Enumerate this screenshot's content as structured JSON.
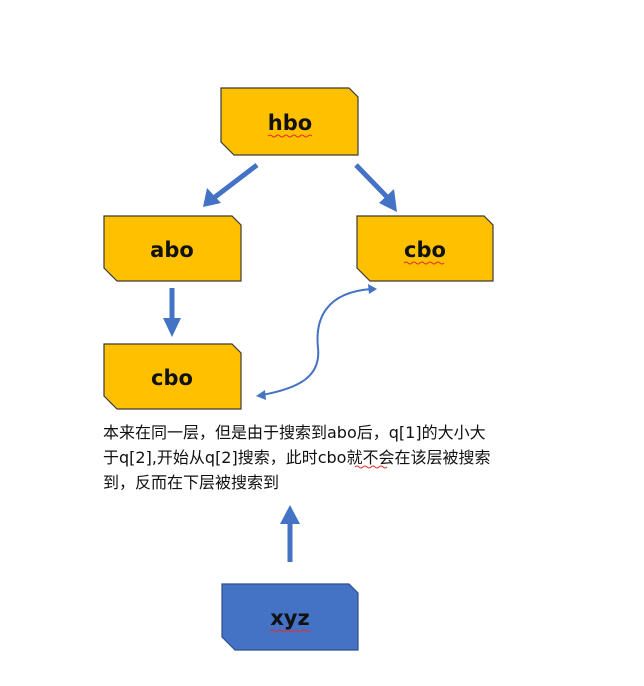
{
  "colors": {
    "node_fill": "#FFC000",
    "node_stroke": "#3a3a3a",
    "query_fill": "#4472C4",
    "query_stroke": "#2f4f8a",
    "arrow": "#4472C4",
    "spell_underline": "#e0302a"
  },
  "nodes": {
    "hbo": {
      "label": "hbo"
    },
    "abo": {
      "label": "abo"
    },
    "cbo_right": {
      "label": "cbo"
    },
    "cbo_lower": {
      "label": "cbo"
    },
    "xyz": {
      "label": "xyz"
    }
  },
  "caption": {
    "lines": [
      "本来在同一层，但是由于搜索到abo后，q[1]的大小大",
      "于q[2],开始从q[2]搜索，此时cbo就不会在该层被搜索",
      "到，反而在下层被搜索到"
    ]
  }
}
